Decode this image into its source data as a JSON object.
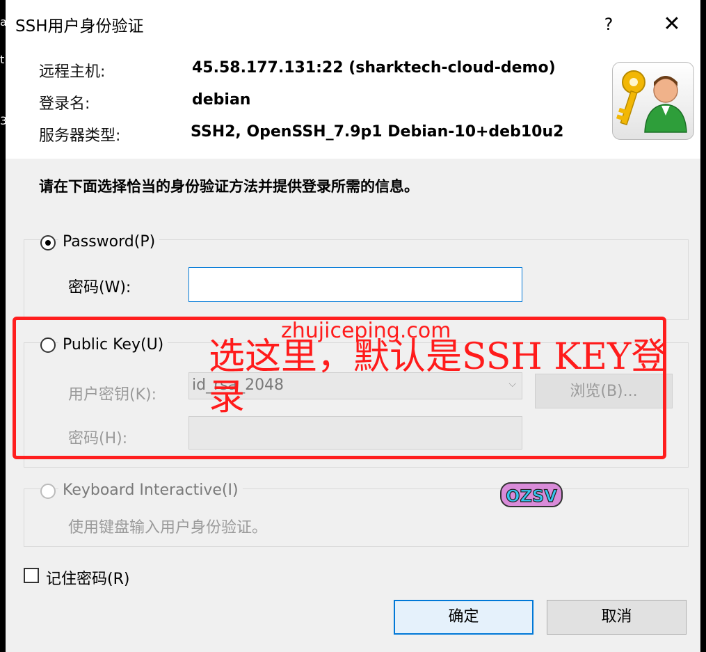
{
  "left_strip": [
    "a",
    "t",
    "3"
  ],
  "dialog": {
    "title": "SSH用户身份验证",
    "help_label": "?",
    "close_label": "✕"
  },
  "info": {
    "host_label": "远程主机:",
    "host_value": "45.58.177.131:22 (sharktech-cloud-demo)",
    "login_label": "登录名:",
    "login_value": "debian",
    "server_label": "服务器类型:",
    "server_value": "SSH2, OpenSSH_7.9p1 Debian-10+deb10u2",
    "avatar_icon": "user-key-icon"
  },
  "instruction": "请在下面选择恰当的身份验证方法并提供登录所需的信息。",
  "password_option": {
    "label": "Password(P)",
    "checked": true,
    "field_label": "密码(W):",
    "value": ""
  },
  "publickey_option": {
    "label": "Public Key(U)",
    "checked": false,
    "key_label": "用户密钥(K):",
    "key_value": "id_rsa_2048",
    "browse_label": "浏览(B)...",
    "passphrase_label": "密码(H):"
  },
  "keyboard_option": {
    "label": "Keyboard Interactive(I)",
    "checked": false,
    "description": "使用键盘输入用户身份验证。"
  },
  "remember": {
    "label": "记住密码(R)",
    "checked": false
  },
  "buttons": {
    "ok": "确定",
    "cancel": "取消"
  },
  "overlay": {
    "watermark": "zhujiceping.com",
    "annotation": "选这里，默认是SSH KEY登录",
    "sticker": "OZSV",
    "highlight_color": "#ff1e1e"
  }
}
